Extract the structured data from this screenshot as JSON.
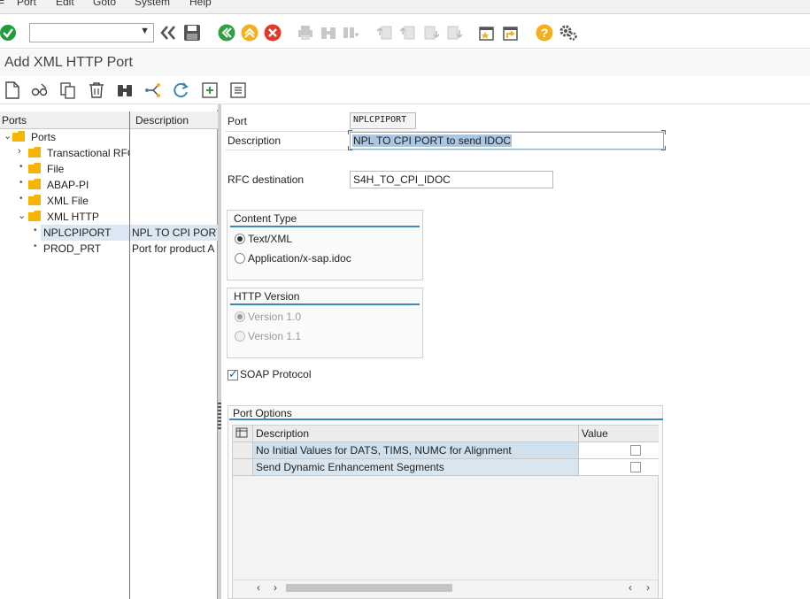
{
  "menubar": {
    "items": [
      "Port",
      "Edit",
      "Goto",
      "System",
      "Help"
    ]
  },
  "command_field": {
    "value": ""
  },
  "title": "Add XML HTTP Port",
  "tree": {
    "col_ports": "Ports",
    "col_description": "Description",
    "root": "Ports",
    "items": [
      "Transactional RFC",
      "File",
      "ABAP-PI",
      "XML File",
      "XML HTTP"
    ],
    "children": [
      {
        "name": "NPLCPIPORT",
        "desc": "NPL TO CPI PORT"
      },
      {
        "name": "PROD_PRT",
        "desc": "Port for product A"
      }
    ]
  },
  "form": {
    "port_label": "Port",
    "port_value": "NPLCPIPORT",
    "description_label": "Description",
    "description_value": "NPL TO CPI PORT to send IDOC",
    "rfc_label": "RFC destination",
    "rfc_value": "S4H_TO_CPI_IDOC",
    "content_type": {
      "title": "Content Type",
      "options": [
        "Text/XML",
        "Application/x-sap.idoc"
      ],
      "selected": "Text/XML"
    },
    "http_version": {
      "title": "HTTP Version",
      "options": [
        "Version 1.0",
        "Version 1.1"
      ],
      "selected": "Version 1.0"
    },
    "soap_label": "SOAP Protocol",
    "soap_checked": true,
    "port_options": {
      "title": "Port Options",
      "col_description": "Description",
      "col_value": "Value",
      "rows": [
        {
          "description": "No Initial Values for DATS, TIMS, NUMC for Alignment",
          "checked": false
        },
        {
          "description": "Send Dynamic Enhancement Segments",
          "checked": false
        }
      ]
    }
  },
  "colors": {
    "accent": "#3b8ab5",
    "ok_green": "#1f9d3a",
    "nav_green": "#2ea043",
    "nav_yellow": "#f2b01e",
    "nav_red": "#e23b2e",
    "folder": "#f4b400"
  }
}
